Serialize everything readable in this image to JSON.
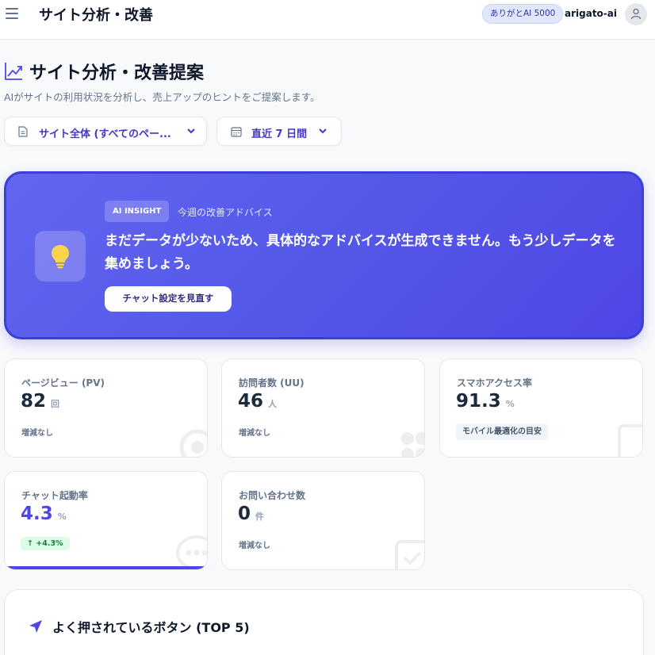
{
  "header": {
    "title": "サイト分析・改善",
    "credit_badge": "ありがとAI 5000",
    "username": "arigato-ai",
    "menu_icon": "hamburger-icon",
    "avatar_icon": "user-icon"
  },
  "page": {
    "title": "サイト分析・改善提案",
    "subtitle": "AIがサイトの利用状況を分析し、売上アップのヒントをご提案します。",
    "title_icon": "trend-chart-icon"
  },
  "filters": {
    "page_scope": "サイト全体 (すべてのペー...",
    "date_range": "直近 7 日間"
  },
  "insight": {
    "tag": "AI INSIGHT",
    "subtag": "今週の改善アドバイス",
    "message": "まだデータが少ないため、具体的なアドバイスが生成できません。もう少しデータを集めましょう。",
    "button": "チャット設定を見直す",
    "icon": "lightbulb-icon"
  },
  "stats": [
    {
      "label": "ページビュー (PV)",
      "value": "82",
      "unit": "回",
      "note": "増減なし"
    },
    {
      "label": "訪問者数 (UU)",
      "value": "46",
      "unit": "人",
      "note": "増減なし"
    },
    {
      "label": "スマホアクセス率",
      "value": "91.3",
      "unit": "%",
      "note": "モバイル最適化の目安"
    },
    {
      "label": "チャット起動率",
      "value": "4.3",
      "unit": "%",
      "note": "↑ +4.3%"
    },
    {
      "label": "お問い合わせ数",
      "value": "0",
      "unit": "件",
      "note": "増減なし"
    }
  ],
  "top_buttons": {
    "title": "よく押されているボタン (TOP 5)",
    "icon": "cursor-arrow-icon"
  },
  "colors": {
    "accent": "#4f46e5",
    "insight_bg": "#5458e8",
    "positive": "#15803d"
  }
}
